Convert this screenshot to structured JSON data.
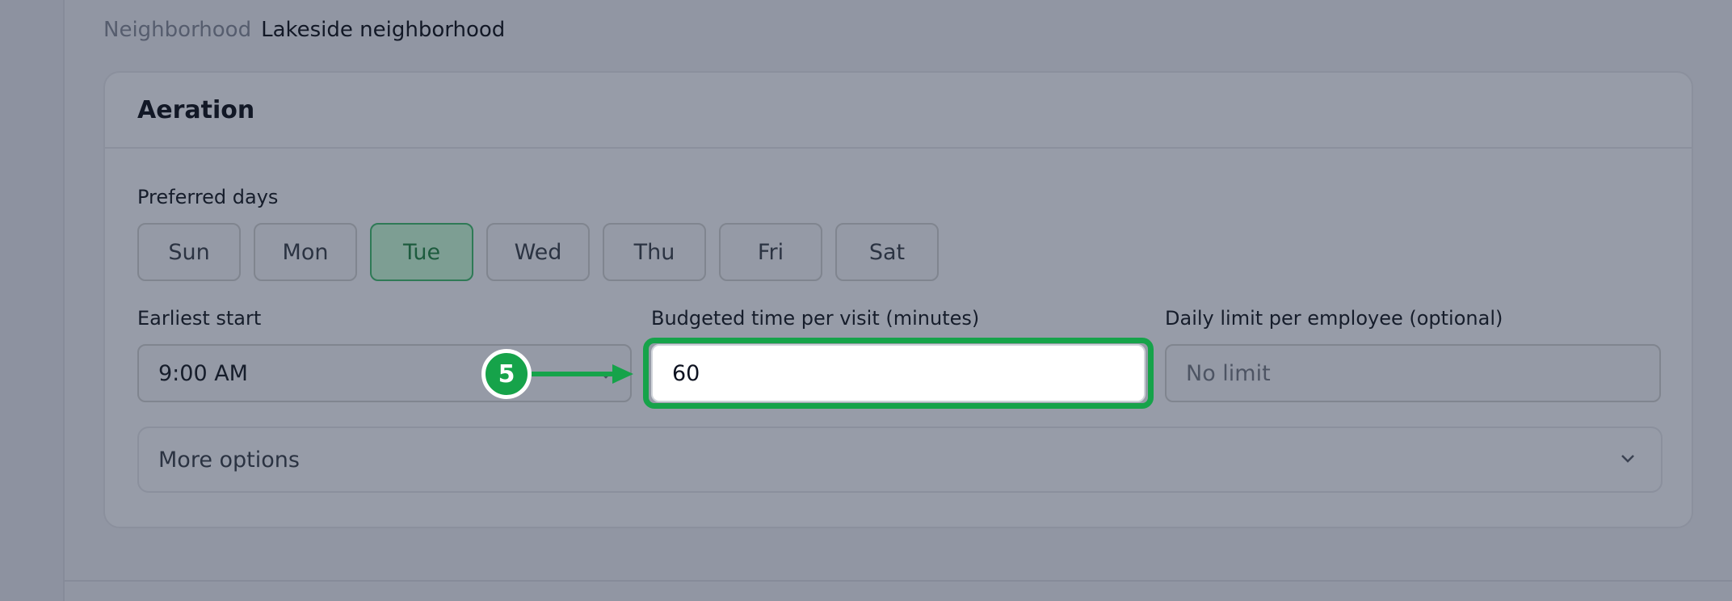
{
  "neighborhood": {
    "label": "Neighborhood",
    "value": "Lakeside neighborhood"
  },
  "card": {
    "title": "Aeration",
    "preferred_days": {
      "label": "Preferred days",
      "days": [
        {
          "label": "Sun",
          "selected": false
        },
        {
          "label": "Mon",
          "selected": false
        },
        {
          "label": "Tue",
          "selected": true
        },
        {
          "label": "Wed",
          "selected": false
        },
        {
          "label": "Thu",
          "selected": false
        },
        {
          "label": "Fri",
          "selected": false
        },
        {
          "label": "Sat",
          "selected": false
        }
      ]
    },
    "earliest_start": {
      "label": "Earliest start",
      "value": "9:00 AM"
    },
    "budgeted_time": {
      "label": "Budgeted time per visit (minutes)",
      "value": "60"
    },
    "daily_limit": {
      "label": "Daily limit per employee (optional)",
      "placeholder": "No limit"
    },
    "more_options": {
      "label": "More options"
    }
  },
  "annotation": {
    "step": "5",
    "color": "#16a34a"
  },
  "icons": [
    "chevron-down-icon",
    "arrow-right-icon"
  ]
}
